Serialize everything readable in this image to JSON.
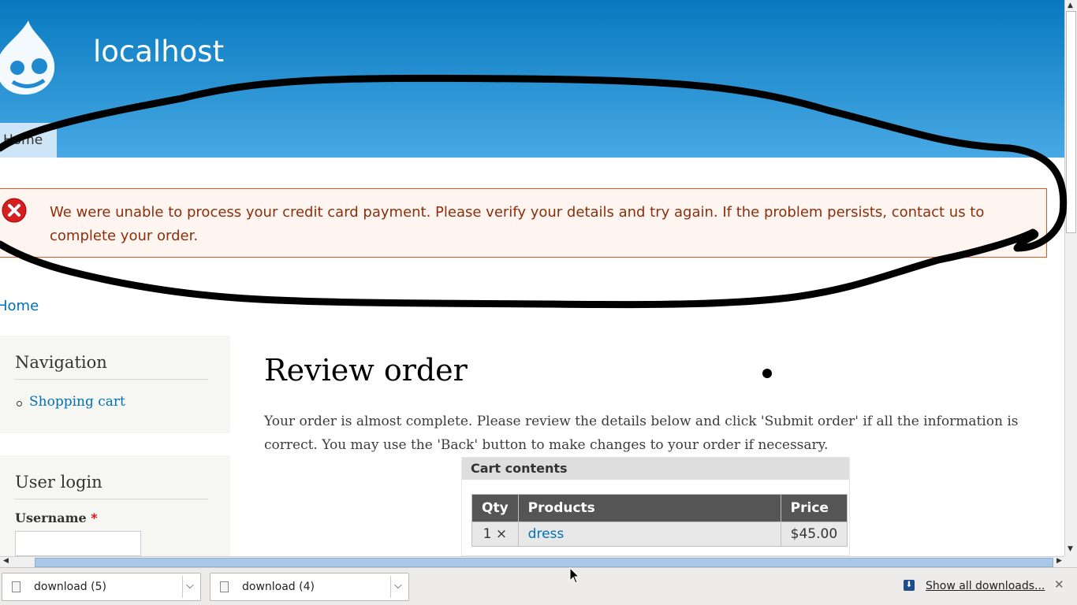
{
  "header": {
    "site_name": "localhost",
    "menu_home": "Home"
  },
  "messages": {
    "error": "We were unable to process your credit card payment. Please verify your details and try again. If the problem persists, contact us to complete your order."
  },
  "breadcrumb": {
    "home": "Home"
  },
  "sidebar": {
    "navigation": {
      "title": "Navigation",
      "links": [
        "Shopping cart"
      ]
    },
    "user_login": {
      "title": "User login",
      "username_label": "Username",
      "required_marker": "*"
    }
  },
  "main": {
    "title": "Review order",
    "intro": "Your order is almost complete. Please review the details below and click 'Submit order' if all the information is correct. You may use the 'Back' button to make changes to your order if necessary.",
    "cart": {
      "legend": "Cart contents",
      "headers": {
        "qty": "Qty",
        "products": "Products",
        "price": "Price"
      },
      "rows": [
        {
          "qty": "1 ×",
          "product": "dress",
          "price": "$45.00"
        }
      ]
    }
  },
  "downloads": {
    "items": [
      {
        "name": "download (5)"
      },
      {
        "name": "download (4)"
      }
    ],
    "show_all": "Show all downloads..."
  },
  "colors": {
    "header_top": "#0779bf",
    "header_bottom": "#48a9e4",
    "error_border": "#ed541d",
    "error_text": "#8c2e0b",
    "link": "#0071b3"
  }
}
